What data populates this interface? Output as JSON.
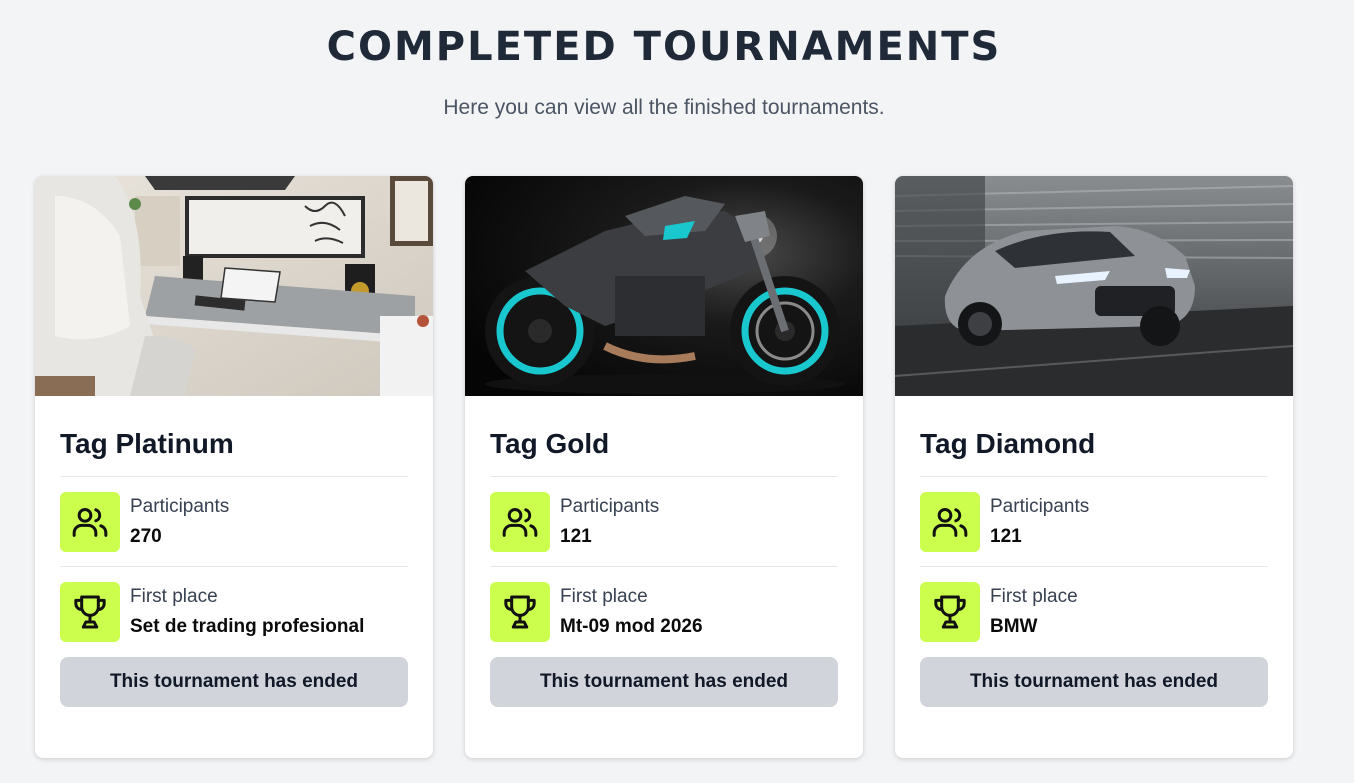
{
  "header": {
    "title": "COMPLETED TOURNAMENTS",
    "subtitle": "Here you can view all the finished tournaments."
  },
  "cards": [
    {
      "title": "Tag Platinum",
      "image": "gaming-desk-setup-image",
      "participants_label": "Participants",
      "participants_value": "270",
      "first_place_label": "First place",
      "first_place_value": "Set de trading profesional",
      "button_label": "This tournament has ended"
    },
    {
      "title": "Tag Gold",
      "image": "motorcycle-image",
      "participants_label": "Participants",
      "participants_value": "121",
      "first_place_label": "First place",
      "first_place_value": "Mt-09 mod 2026",
      "button_label": "This tournament has ended"
    },
    {
      "title": "Tag Diamond",
      "image": "sports-car-image",
      "participants_label": "Participants",
      "participants_value": "121",
      "first_place_label": "First place",
      "first_place_value": "BMW",
      "button_label": "This tournament has ended"
    }
  ],
  "icons": {
    "participants": "users-icon",
    "first_place": "trophy-icon"
  },
  "colors": {
    "accent": "#ccff4d",
    "button_bg": "#d1d5db",
    "page_bg": "#f3f4f6"
  }
}
